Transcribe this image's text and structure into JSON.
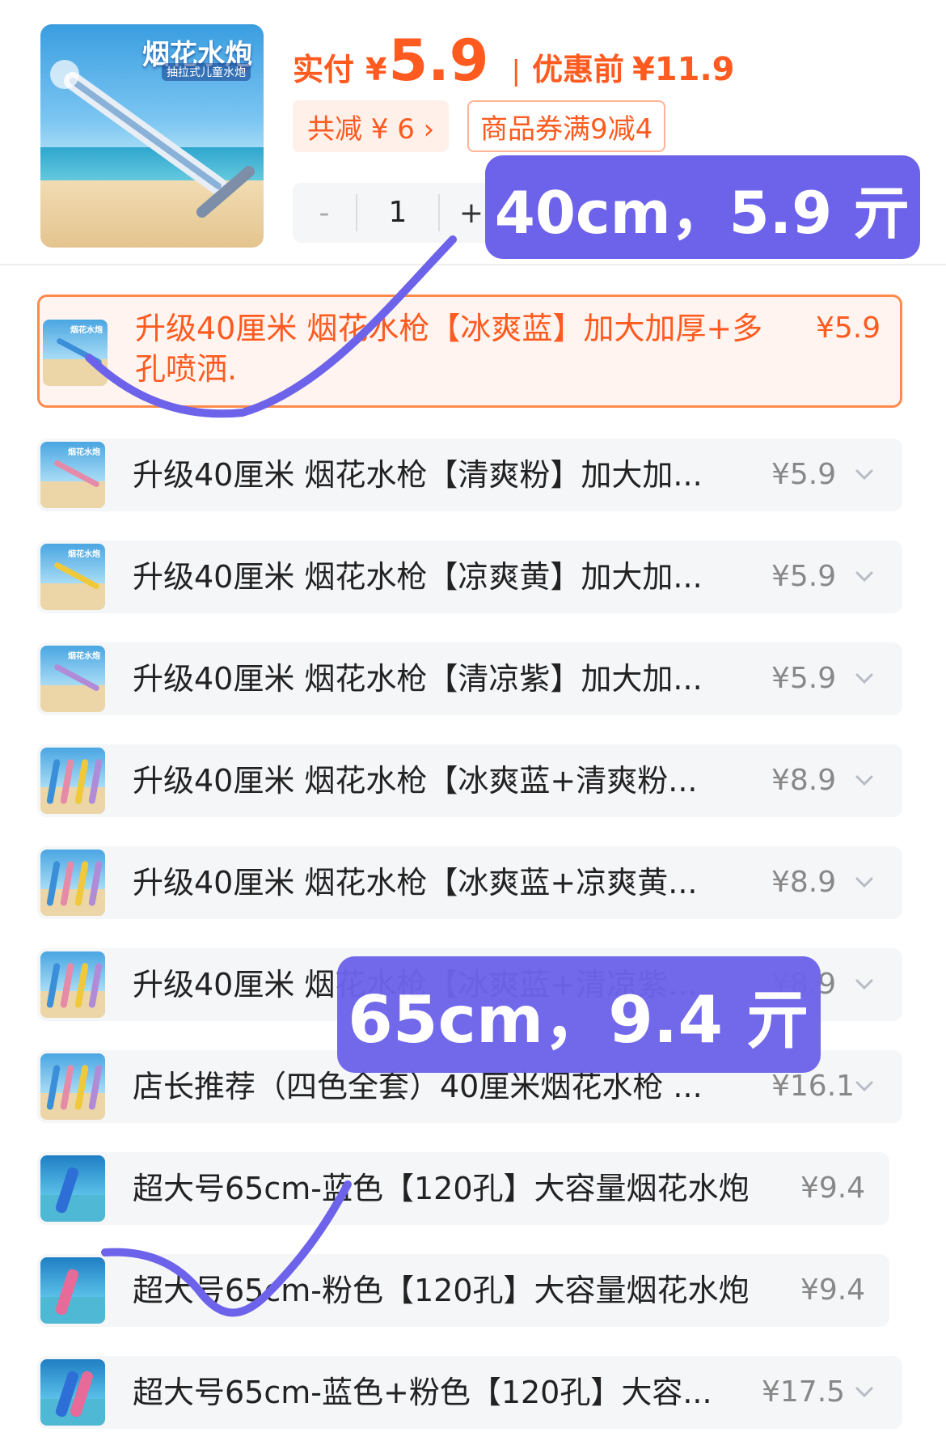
{
  "header": {
    "product_brand": "烟花水炮",
    "product_sub": "抽拉式儿童水炮",
    "pay_label": "实付",
    "currency": "¥",
    "pay_price": "5.9",
    "separator": "|",
    "orig_label": "优惠前",
    "orig_price": "¥11.9",
    "discount_tag": "共减 ¥ 6 ›",
    "coupon_tag": "商品券满9减4",
    "qty_minus": "-",
    "qty_value": "1",
    "qty_plus": "+"
  },
  "skus": [
    {
      "name": "升级40厘米 烟花水枪【冰爽蓝】加大加厚+多孔喷洒.",
      "price": "¥5.9",
      "selected": true,
      "color": "#3a8fd8"
    },
    {
      "name": "升级40厘米 烟花水枪【清爽粉】加大加...",
      "price": "¥5.9",
      "color": "#e58aa8"
    },
    {
      "name": "升级40厘米 烟花水枪【凉爽黄】加大加...",
      "price": "¥5.9",
      "color": "#f0c93a"
    },
    {
      "name": "升级40厘米 烟花水枪【清凉紫】加大加...",
      "price": "¥5.9",
      "color": "#b08bd8"
    },
    {
      "name": "升级40厘米 烟花水枪【冰爽蓝+清爽粉...",
      "price": "¥8.9"
    },
    {
      "name": "升级40厘米 烟花水枪【冰爽蓝+凉爽黄...",
      "price": "¥8.9"
    },
    {
      "name": "升级40厘米 烟花水枪【冰爽蓝+清凉紫...",
      "price": "¥8.9"
    },
    {
      "name": "店长推荐（四色全套）40厘米烟花水枪 ...",
      "price": "¥16.1"
    },
    {
      "name": "超大号65cm-蓝色【120孔】大容量烟花水炮",
      "price": "¥9.4"
    },
    {
      "name": "超大号65cm-粉色【120孔】大容量烟花水炮",
      "price": "¥9.4"
    },
    {
      "name": "超大号65cm-蓝色+粉色【120孔】大容...",
      "price": "¥17.5"
    }
  ],
  "overlays": {
    "label_40": "40cm，5.9 亓",
    "label_65": "65cm，9.4 亓",
    "mark_color": "#6d63ea"
  },
  "colors": {
    "accent": "#ff5a1f",
    "selected_border": "#ff8a4c",
    "row_bg": "#f5f6f8"
  }
}
